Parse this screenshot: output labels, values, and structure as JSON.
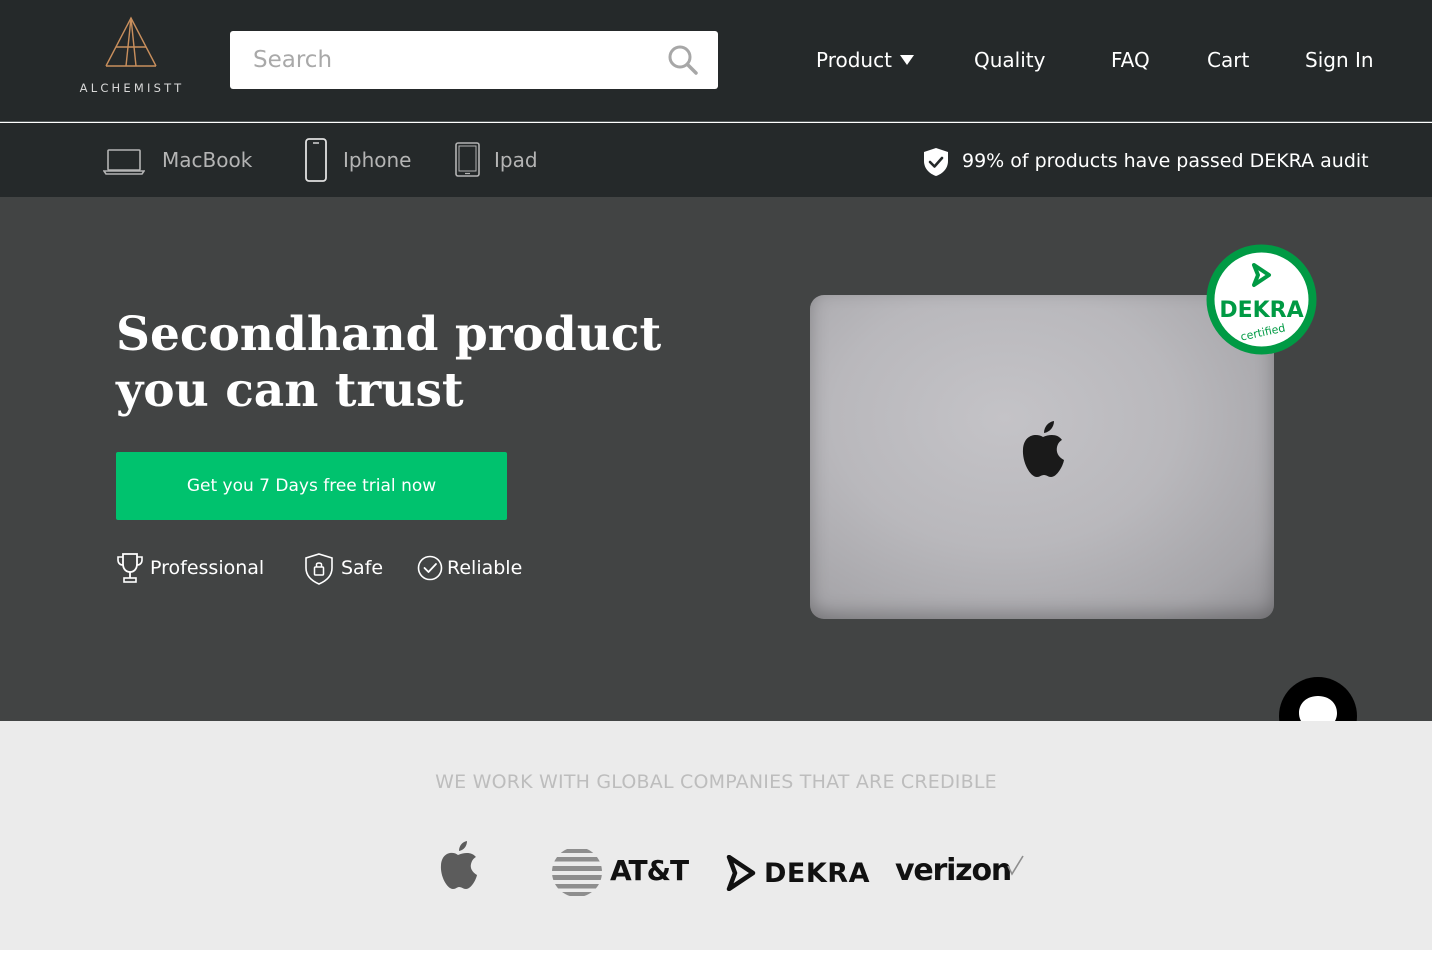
{
  "brand": {
    "name": "ALCHEMISTT",
    "logo_color": "#c98f5d"
  },
  "search": {
    "placeholder": "Search"
  },
  "nav": {
    "product": "Product",
    "quality": "Quality",
    "faq": "FAQ",
    "cart": "Cart",
    "sign_in": "Sign In"
  },
  "categories": [
    {
      "label": "MacBook",
      "icon": "laptop-icon"
    },
    {
      "label": "Iphone",
      "icon": "phone-icon"
    },
    {
      "label": "Ipad",
      "icon": "tablet-icon"
    }
  ],
  "audit_notice": {
    "text": "99% of products have passed DEKRA audit",
    "icon": "shield-check-icon"
  },
  "hero": {
    "title_line1": "Secondhand product",
    "title_line2": "you can trust",
    "cta_label": "Get you 7 Days free trial now",
    "cta_color": "#00c26e",
    "features": [
      {
        "label": "Professional",
        "icon": "trophy-icon"
      },
      {
        "label": "Safe",
        "icon": "shield-lock-icon"
      },
      {
        "label": "Reliable",
        "icon": "check-circle-icon"
      }
    ],
    "badge": {
      "brand": "DEKRA",
      "caption": "certified",
      "color": "#009a44"
    }
  },
  "partners": {
    "heading": "WE WORK WITH GLOBAL COMPANIES THAT ARE CREDIBLE",
    "logos": [
      {
        "name": "apple-logo"
      },
      {
        "name": "att-logo",
        "text": "AT&T"
      },
      {
        "name": "dekra-logo",
        "text": "DEKRA"
      },
      {
        "name": "verizon-logo",
        "text": "verizon"
      }
    ]
  },
  "chat": {
    "icon": "chat-bubble-icon"
  }
}
